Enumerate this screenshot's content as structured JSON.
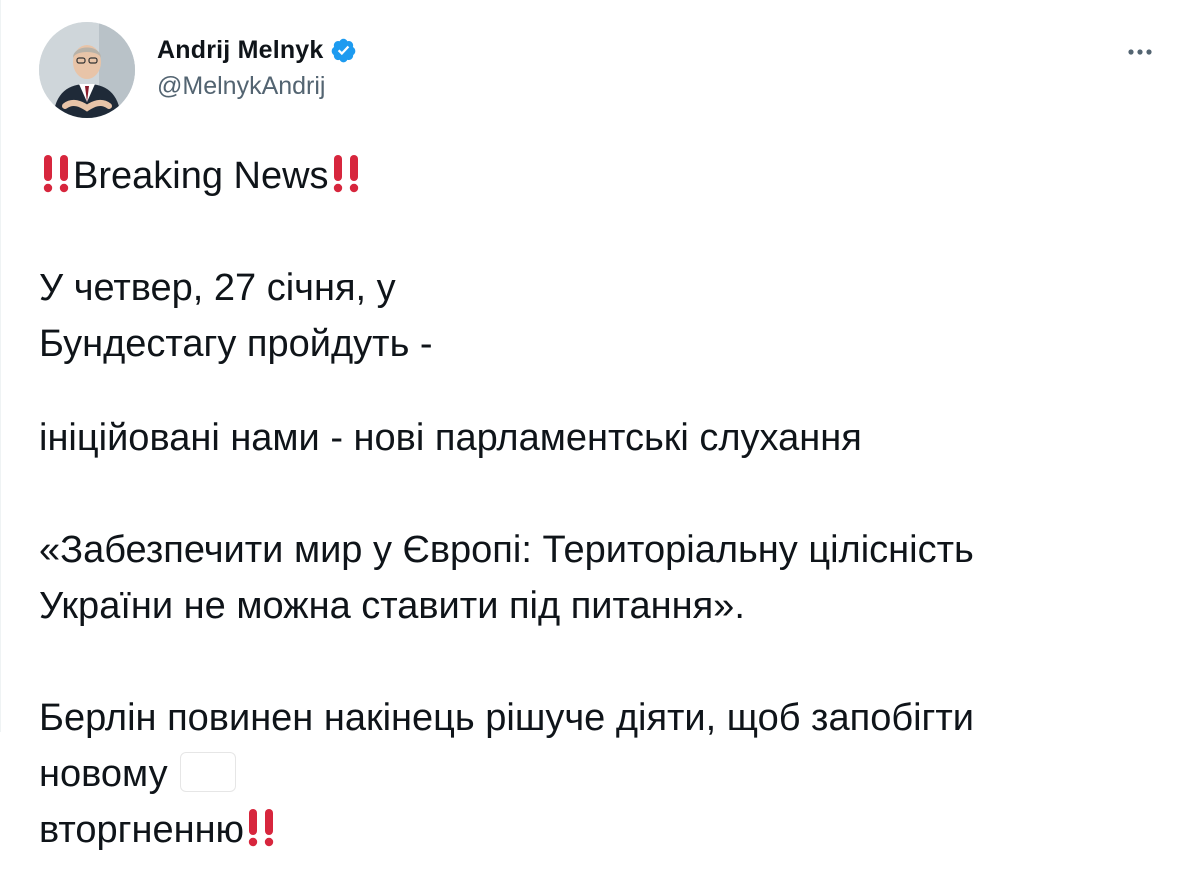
{
  "author": {
    "display_name": "Andrij Melnyk",
    "handle": "@MelnykAndrij",
    "verified": true,
    "avatar_icon": "profile-photo"
  },
  "menu": {
    "more_icon": "more-horizontal-icon"
  },
  "tweet": {
    "headline": "Breaking News",
    "p1_before_flag": "У четвер, 27 січня, у ",
    "p1_after_flag_line1": "Бундестагу пройдуть -",
    "p1_line2": "ініційовані нами - нові парламентські слухання",
    "p2_line1": "«Забезпечити мир у Європі: Територіальну цілісність",
    "p2_line2": "України не можна ставити під питання».",
    "p3_line1": "Берлін повинен накінець рішуче діяти, щоб запобігти",
    "p3_line2_before_flag": "новому ",
    "p3_line2_after_flag": " вторгненню"
  },
  "emoji": {
    "double_exclamation_color": "#d7263d",
    "germany_flag": [
      "#000000",
      "#dd0000",
      "#ffce00"
    ],
    "russia_flag": [
      "#ffffff",
      "#0039a6",
      "#d52b1e"
    ]
  },
  "colors": {
    "text_primary": "#0f1419",
    "text_secondary": "#536471",
    "verified_blue": "#1d9bf0"
  }
}
